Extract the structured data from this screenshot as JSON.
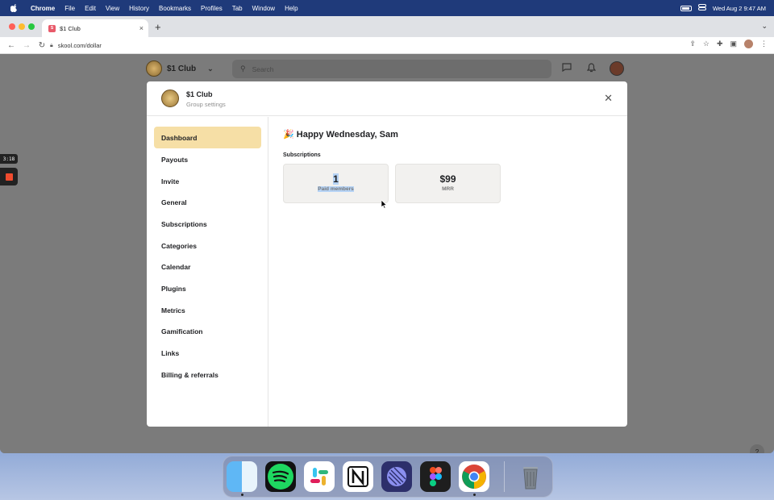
{
  "menubar": {
    "app_name": "Chrome",
    "items": [
      "File",
      "Edit",
      "View",
      "History",
      "Bookmarks",
      "Profiles",
      "Tab",
      "Window",
      "Help"
    ],
    "clock": "Wed Aug 2  9:47 AM"
  },
  "browser": {
    "tab_title": "$1 Club",
    "url": "skool.com/dollar"
  },
  "site": {
    "group_name": "$1 Club",
    "search_placeholder": "Search",
    "help_label": "?"
  },
  "recorder": {
    "time": "3:18"
  },
  "modal": {
    "title": "$1 Club",
    "subtitle": "Group settings",
    "nav": [
      {
        "label": "Dashboard",
        "active": true
      },
      {
        "label": "Payouts"
      },
      {
        "label": "Invite"
      },
      {
        "label": "General"
      },
      {
        "label": "Subscriptions"
      },
      {
        "label": "Categories"
      },
      {
        "label": "Calendar"
      },
      {
        "label": "Plugins"
      },
      {
        "label": "Metrics"
      },
      {
        "label": "Gamification"
      },
      {
        "label": "Links"
      },
      {
        "label": "Billing & referrals"
      }
    ],
    "greeting_emoji": "🎉",
    "greeting": "Happy Wednesday, Sam",
    "section_label": "Subscriptions",
    "stats": [
      {
        "value": "1",
        "label": "Paid members"
      },
      {
        "value": "$99",
        "label": "MRR"
      }
    ]
  },
  "dock": {
    "apps": [
      "finder",
      "spotify",
      "slack",
      "notion",
      "linear",
      "figma",
      "chrome",
      "trash"
    ]
  }
}
